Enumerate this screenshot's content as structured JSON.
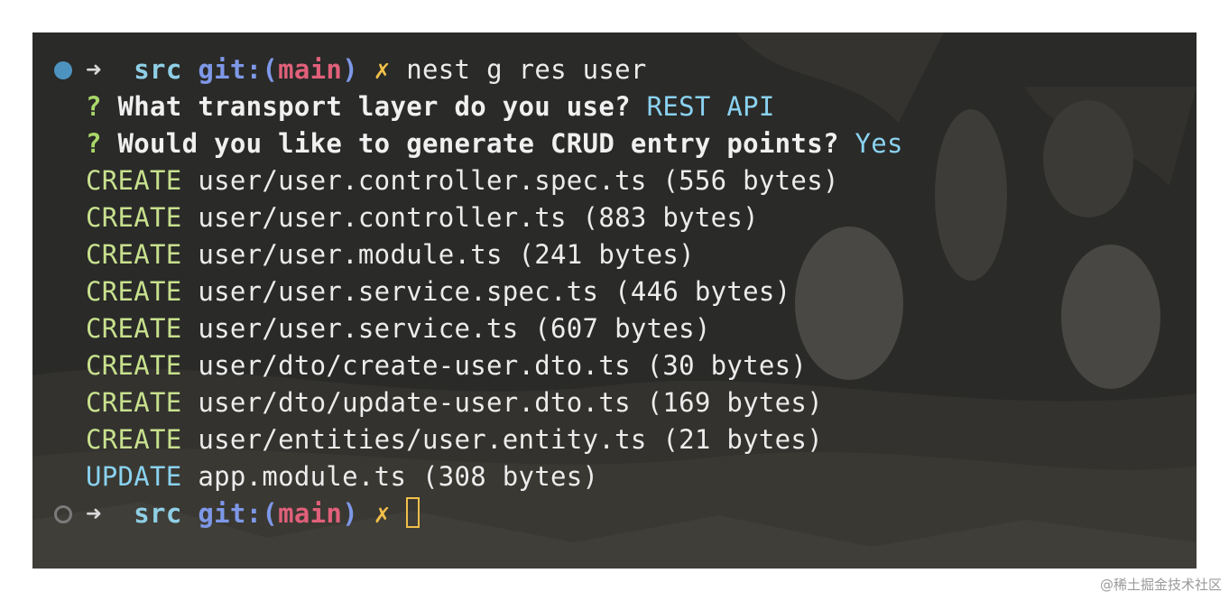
{
  "prompt": {
    "arrow": "➜",
    "dir": "src",
    "git_label": "git:(",
    "branch": "main",
    "git_close": ")",
    "dirty_mark": "✗",
    "command": "nest g res user"
  },
  "questions": [
    {
      "mark": "?",
      "text": "What transport layer do you use?",
      "answer": "REST API"
    },
    {
      "mark": "?",
      "text": "Would you like to generate CRUD entry points?",
      "answer": "Yes"
    }
  ],
  "files": [
    {
      "action": "CREATE",
      "path": "user/user.controller.spec.ts (556 bytes)"
    },
    {
      "action": "CREATE",
      "path": "user/user.controller.ts (883 bytes)"
    },
    {
      "action": "CREATE",
      "path": "user/user.module.ts (241 bytes)"
    },
    {
      "action": "CREATE",
      "path": "user/user.service.spec.ts (446 bytes)"
    },
    {
      "action": "CREATE",
      "path": "user/user.service.ts (607 bytes)"
    },
    {
      "action": "CREATE",
      "path": "user/dto/create-user.dto.ts (30 bytes)"
    },
    {
      "action": "CREATE",
      "path": "user/dto/update-user.dto.ts (169 bytes)"
    },
    {
      "action": "CREATE",
      "path": "user/entities/user.entity.ts (21 bytes)"
    },
    {
      "action": "UPDATE",
      "path": "app.module.ts (308 bytes)"
    }
  ],
  "watermark": "@稀土掘金技术社区",
  "colors": {
    "terminal_bg": "#282826",
    "create": "#c7e08d",
    "update": "#8ad2f0",
    "branch": "#e0607a",
    "git": "#7e98e8",
    "dir": "#8fcfe6",
    "dirty_mark": "#f1c04a",
    "status_dot_active": "#4d93c0"
  },
  "icons": [
    "status-dot-active-icon",
    "arrow-icon",
    "status-dot-idle-icon",
    "cursor-icon"
  ]
}
